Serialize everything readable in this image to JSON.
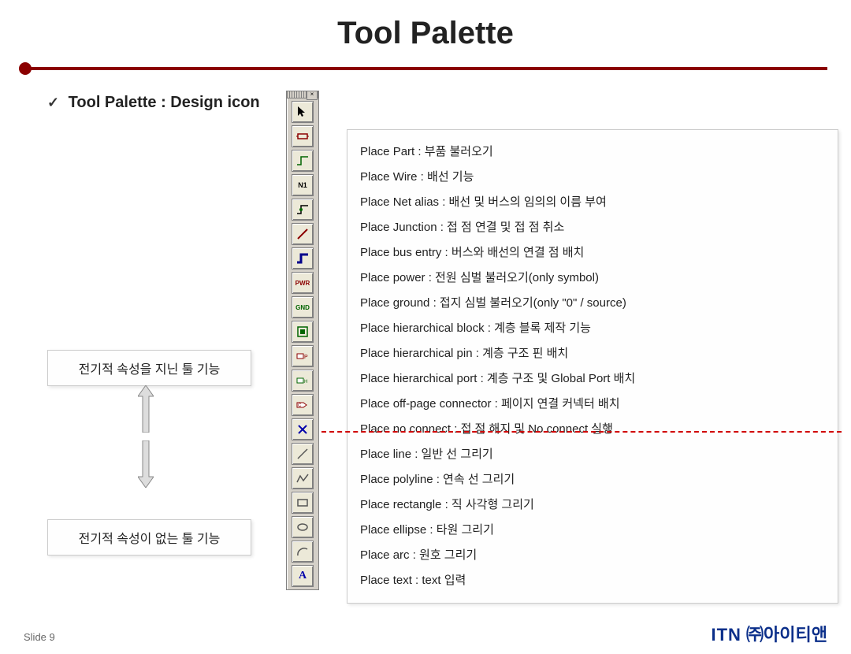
{
  "title": "Tool Palette",
  "subhead": "Tool Palette : Design icon",
  "note1": "전기적 속성을 지닌 툴 기능",
  "note2": "전기적 속성이 없는 툴 기능",
  "palette_icons": [
    "cursor",
    "part",
    "wire",
    "netalias",
    "junction",
    "busentry",
    "bus",
    "power",
    "ground",
    "hblock",
    "hpin",
    "hport",
    "offpage",
    "noconnect",
    "line",
    "polyline",
    "rect",
    "ellipse",
    "arc",
    "text"
  ],
  "desc": [
    "Place Part : 부품 불러오기",
    "Place Wire : 배선 기능",
    "Place Net alias : 배선 및 버스의 임의의 이름 부여",
    "Place Junction : 접 점 연결 및 접 점 취소",
    "Place bus entry : 버스와 배선의 연결 점 배치",
    "Place power : 전원 심벌 불러오기(only symbol)",
    "Place ground : 접지 심벌 불러오기(only \"0\" / source)",
    "Place hierarchical block : 계층 블록 제작 기능",
    "Place hierarchical pin : 계층 구조 핀 배치",
    "Place hierarchical port : 계층 구조 및 Global Port 배치",
    "Place off-page connector : 페이지 연결 커넥터 배치",
    "Place no connect : 접 점 해지 및 No connect 실행",
    "Place line : 일반 선 그리기",
    "Place polyline : 연속 선 그리기",
    "Place rectangle : 직 사각형 그리기",
    "Place ellipse : 타원 그리기",
    "Place arc : 원호 그리기",
    "Place text : text 입력"
  ],
  "footer_left": "Slide 9",
  "footer_itn": "ITN",
  "footer_ko": " ㈜아이티앤"
}
